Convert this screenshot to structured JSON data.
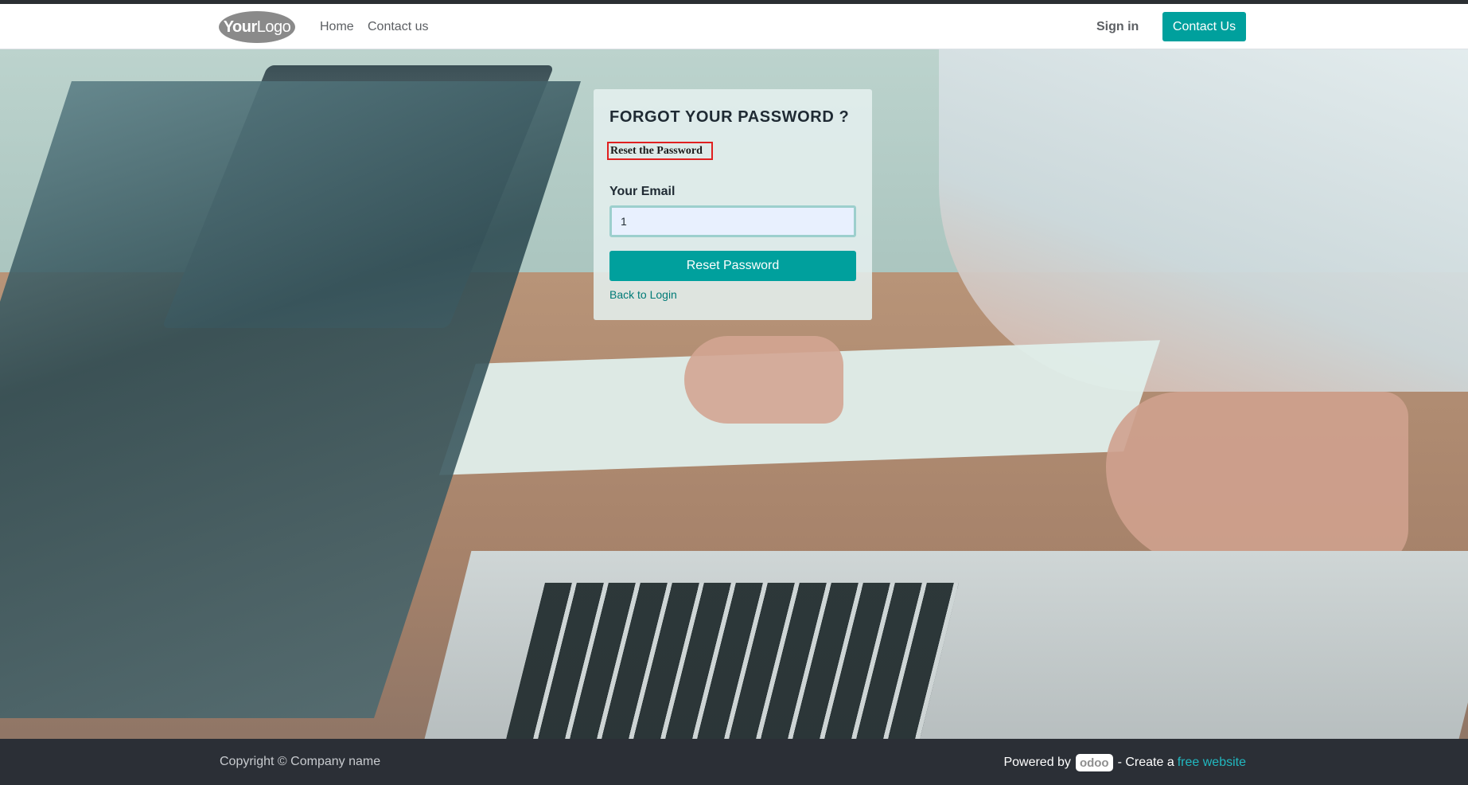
{
  "header": {
    "logo": {
      "bold": "Your",
      "rest": "Logo"
    },
    "nav": [
      {
        "label": "Home"
      },
      {
        "label": "Contact us"
      }
    ],
    "signin_label": "Sign in",
    "contact_button_label": "Contact Us"
  },
  "card": {
    "title": "FORGOT YOUR PASSWORD ?",
    "subtitle": "Reset the Password",
    "email_label": "Your Email",
    "email_value": "1",
    "reset_button_label": "Reset Password",
    "back_link_label": "Back to Login"
  },
  "footer": {
    "copyright": "Copyright © Company name",
    "powered_by": "Powered by",
    "odoo_badge": "odoo",
    "create_text": "- Create a",
    "free_website_link": "free website"
  },
  "colors": {
    "accent": "#00a09d",
    "footer_bg": "#2b2f36",
    "link": "#21b8c0",
    "highlight_border": "#e02020"
  }
}
